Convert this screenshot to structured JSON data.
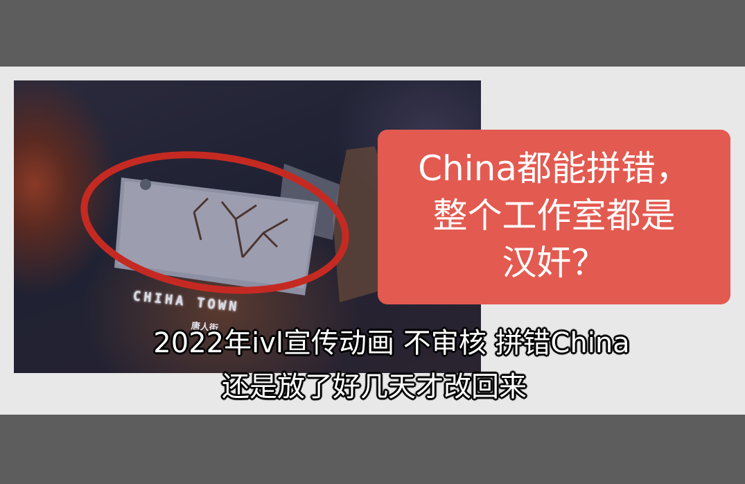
{
  "colors": {
    "band": "#5d5d5d",
    "panel": "#e8e8e8",
    "callout_bg": "#e35a50",
    "circle_stroke": "#c52a22"
  },
  "photo": {
    "card_text": "CHIHA TOWN",
    "card_subtext": "唐人街"
  },
  "callout": {
    "lines": [
      "China都能拼错，",
      "整个工作室都是",
      "汉奸？"
    ]
  },
  "caption": {
    "line1": "2022年ivl宣传动画 不审核 拼错China",
    "line2": "还是放了好几天才改回来"
  }
}
